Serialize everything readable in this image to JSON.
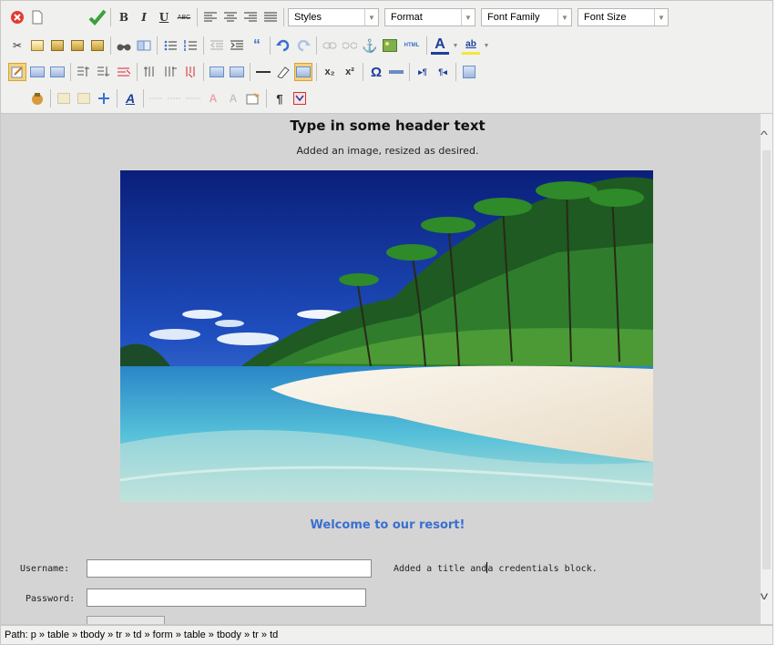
{
  "toolbar": {
    "row1": {
      "styles": "Styles",
      "format": "Format",
      "font_family": "Font Family",
      "font_size": "Font Size",
      "bold": "B",
      "italic": "I",
      "underline": "U",
      "strike": "ABC"
    },
    "row2": {
      "html": "HTML",
      "quote": "“",
      "font_color": "A",
      "highlight": "ab"
    },
    "row3": {
      "subscript": "x₂",
      "superscript": "x²",
      "omega": "Ω"
    },
    "row4": {
      "pilcrow": "¶",
      "styleprops": "A"
    }
  },
  "document": {
    "title": "Type in some header text",
    "subtitle": "Added an image, resized as desired.",
    "welcome": "Welcome to our resort!",
    "username_label": "Username:",
    "password_label": "Password:",
    "note_before": "Added a title and",
    "note_after": "a credentials block.",
    "username_value": "",
    "password_value": ""
  },
  "statusbar": {
    "path": "Path: p » table » tbody » tr » td » form » table » tbody » tr » td"
  },
  "colors": {
    "accent_blue": "#3a6fcf",
    "editor_bg": "#d4d4d4",
    "toolbar_bg": "#f0f0ee",
    "active_button": "#f4d27a"
  }
}
